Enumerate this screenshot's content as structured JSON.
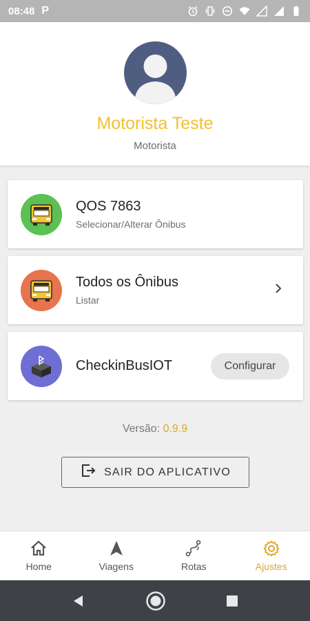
{
  "status_bar": {
    "time": "08:48",
    "app_icon": "P"
  },
  "profile": {
    "name": "Motorista Teste",
    "role": "Motorista",
    "name_color": "#f2c12e",
    "avatar_color": "#4f5d80"
  },
  "cards": [
    {
      "title": "QOS 7863",
      "subtitle": "Selecionar/Alterar Ônibus",
      "icon": "school-bus-icon",
      "icon_bg": "#5cc152"
    },
    {
      "title": "Todos os Ônibus",
      "subtitle": "Listar",
      "icon": "school-bus-icon",
      "icon_bg": "#e8734f",
      "action": "chevron-right-icon"
    },
    {
      "title": "CheckinBusIOT",
      "icon": "bluetooth-box-icon",
      "icon_bg": "#6e6ed4",
      "button_label": "Configurar"
    }
  ],
  "version": {
    "label": "Versão:",
    "number": "0.9.9"
  },
  "exit_button": {
    "label": "SAIR DO APLICATIVO",
    "icon": "exit-icon"
  },
  "bottom_nav": [
    {
      "label": "Home",
      "icon": "home-icon",
      "active": false
    },
    {
      "label": "Viagens",
      "icon": "navigation-arrow-icon",
      "active": false
    },
    {
      "label": "Rotas",
      "icon": "route-icon",
      "active": false
    },
    {
      "label": "Ajustes",
      "icon": "gear-icon",
      "active": true
    }
  ],
  "colors": {
    "accent": "#d9a829",
    "status_bar": "#b5b5b5",
    "system_nav": "#3e4247"
  }
}
